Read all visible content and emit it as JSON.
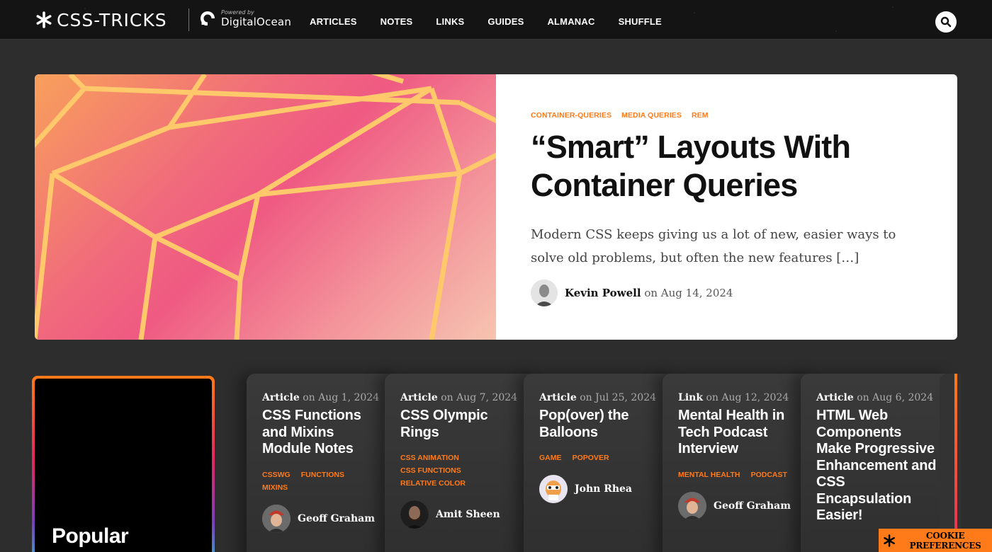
{
  "header": {
    "logo_text": "CSS-TRICKS",
    "powered_by": "Powered by",
    "sponsor": "DigitalOcean",
    "nav": [
      "ARTICLES",
      "NOTES",
      "LINKS",
      "GUIDES",
      "ALMANAC",
      "SHUFFLE"
    ]
  },
  "hero": {
    "tags": [
      "CONTAINER-QUERIES",
      "MEDIA QUERIES",
      "REM"
    ],
    "title_line1": "“Smart” Layouts With",
    "title_line2": "Container Queries",
    "excerpt": "Modern CSS keeps giving us a lot of new, easier ways to solve old problems, but often the new features […]",
    "author": "Kevin Powell",
    "date_prefix": "on",
    "date": "Aug 14, 2024"
  },
  "popular": {
    "title": "Popular"
  },
  "cards": [
    {
      "type": "Article",
      "date": "on Aug 1, 2024",
      "title": "CSS Functions and Mixins Module Notes",
      "tags": [
        "CSSWG",
        "FUNCTIONS",
        "MIXINS"
      ],
      "author": "Geoff Graham"
    },
    {
      "type": "Article",
      "date": "on Aug 7, 2024",
      "title": "CSS Olympic Rings",
      "tags": [
        "CSS ANIMATION",
        "CSS FUNCTIONS",
        "RELATIVE COLOR"
      ],
      "author": "Amit Sheen"
    },
    {
      "type": "Article",
      "date": "on Jul 25, 2024",
      "title": "Pop(over) the Balloons",
      "tags": [
        "GAME",
        "POPOVER"
      ],
      "author": "John Rhea"
    },
    {
      "type": "Link",
      "date": "on Aug 12, 2024",
      "title": "Mental Health in Tech Podcast Interview",
      "tags": [
        "MENTAL HEALTH",
        "PODCAST"
      ],
      "author": "Geoff Graham"
    },
    {
      "type": "Article",
      "date": "on Aug 6, 2024",
      "title": "HTML Web Components Make Progressive Enhancement and CSS Encapsulation Easier!",
      "tags": [],
      "author": ""
    }
  ],
  "cookie": {
    "label": "COOKIE PREFERENCES"
  },
  "colors": {
    "accent": "#ff7a18",
    "header_bg": "#141414",
    "page_bg": "#2d2d2d"
  }
}
